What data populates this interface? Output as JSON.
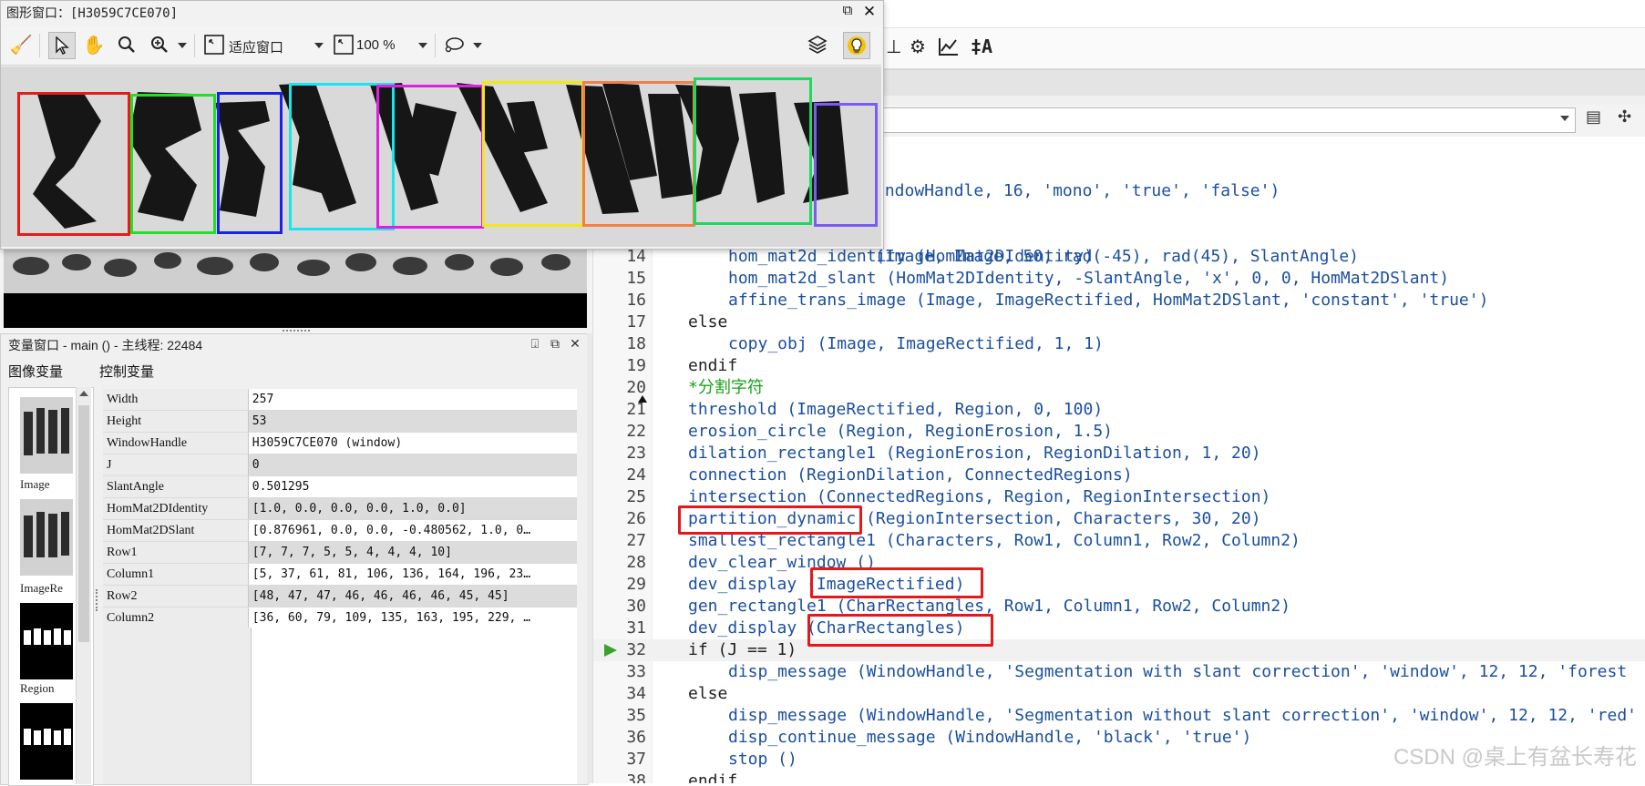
{
  "graphics_window": {
    "title": "图形窗口：[H3059C7CE070]",
    "toolbar": {
      "fit_label": "适应窗口",
      "zoom_label": "100 %"
    },
    "segment_colors": [
      "#e31c1c",
      "#22e022",
      "#1a22e6",
      "#18e6ee",
      "#e21ee2",
      "#f0e81a",
      "#f08048",
      "#1ed860",
      "#7a5cf0"
    ]
  },
  "variable_window": {
    "title": "变量窗口 - main () - 主线程: 22484",
    "tabs": {
      "images": "图像变量",
      "controls": "控制变量"
    },
    "thumbnails": [
      {
        "label": "Image"
      },
      {
        "label": "ImageRe"
      },
      {
        "label": "Region"
      }
    ],
    "controls": [
      {
        "name": "Width",
        "value": "257"
      },
      {
        "name": "Height",
        "value": "53"
      },
      {
        "name": "WindowHandle",
        "value": "H3059C7CE070 (window)"
      },
      {
        "name": "J",
        "value": "0"
      },
      {
        "name": "SlantAngle",
        "value": "0.501295"
      },
      {
        "name": "HomMat2DIdentity",
        "value": "[1.0, 0.0, 0.0, 0.0, 1.0, 0.0]"
      },
      {
        "name": "HomMat2DSlant",
        "value": "[0.876961, 0.0, 0.0, -0.480562, 1.0, 0…"
      },
      {
        "name": "Row1",
        "value": "[7, 7, 7, 5, 5, 4, 4, 4, 10]"
      },
      {
        "name": "Column1",
        "value": "[5, 37, 61, 81, 106, 136, 164, 196, 23…"
      },
      {
        "name": "Row2",
        "value": "[48, 47, 47, 46, 46, 46, 46, 45, 45]"
      },
      {
        "name": "Column2",
        "value": "[36, 60, 79, 109, 135, 163, 195, 229, …"
      }
    ]
  },
  "editor": {
    "partial_lines": [
      "indowHandle, 16, 'mono', 'true', 'false')",
      "(Image, Image, 50, rad(-45), rad(45), SlantAngle)"
    ],
    "lines": [
      {
        "n": "14",
        "text": "hom_mat2d_identity (HomMat2DIdentity)"
      },
      {
        "n": "15",
        "text": "hom_mat2d_slant (HomMat2DIdentity, -SlantAngle, 'x', 0, 0, HomMat2DSlant)"
      },
      {
        "n": "16",
        "text": "affine_trans_image (Image, ImageRectified, HomMat2DSlant, 'constant', 'true')"
      },
      {
        "n": "17",
        "text": "else"
      },
      {
        "n": "18",
        "text": "copy_obj (Image, ImageRectified, 1, 1)"
      },
      {
        "n": "19",
        "text": "endif"
      },
      {
        "n": "20",
        "text": "*分割字符"
      },
      {
        "n": "21",
        "text": "threshold (ImageRectified, Region, 0, 100)"
      },
      {
        "n": "22",
        "text": "erosion_circle (Region, RegionErosion, 1.5)"
      },
      {
        "n": "23",
        "text": "dilation_rectangle1 (RegionErosion, RegionDilation, 1, 20)"
      },
      {
        "n": "24",
        "text": "connection (RegionDilation, ConnectedRegions)"
      },
      {
        "n": "25",
        "text": "intersection (ConnectedRegions, Region, RegionIntersection)"
      },
      {
        "n": "26",
        "text": "partition_dynamic (RegionIntersection, Characters, 30, 20)"
      },
      {
        "n": "27",
        "text": "smallest_rectangle1 (Characters, Row1, Column1, Row2, Column2)"
      },
      {
        "n": "28",
        "text": "dev_clear_window ()"
      },
      {
        "n": "29",
        "text": "dev_display (ImageRectified)"
      },
      {
        "n": "30",
        "text": "gen_rectangle1 (CharRectangles, Row1, Column1, Row2, Column2)"
      },
      {
        "n": "31",
        "text": "dev_display (CharRectangles)"
      },
      {
        "n": "32",
        "text": "if (J == 1)"
      },
      {
        "n": "33",
        "text": "disp_message (WindowHandle, 'Segmentation with slant correction', 'window', 12, 12, 'forest"
      },
      {
        "n": "34",
        "text": "else"
      },
      {
        "n": "35",
        "text": "disp_message (WindowHandle, 'Segmentation without slant correction', 'window', 12, 12, 'red'"
      },
      {
        "n": "36",
        "text": "disp_continue_message (WindowHandle, 'black', 'true')"
      },
      {
        "n": "37",
        "text": "stop ()"
      },
      {
        "n": "38",
        "text": "endif"
      }
    ],
    "watermark": "CSDN @桌上有盆长寿花"
  },
  "colors": {
    "highlight_box": "#e21a1a",
    "code_blue": "#1b4fa0",
    "comment_green": "#18a218",
    "pc_arrow": "#3aa02e"
  }
}
